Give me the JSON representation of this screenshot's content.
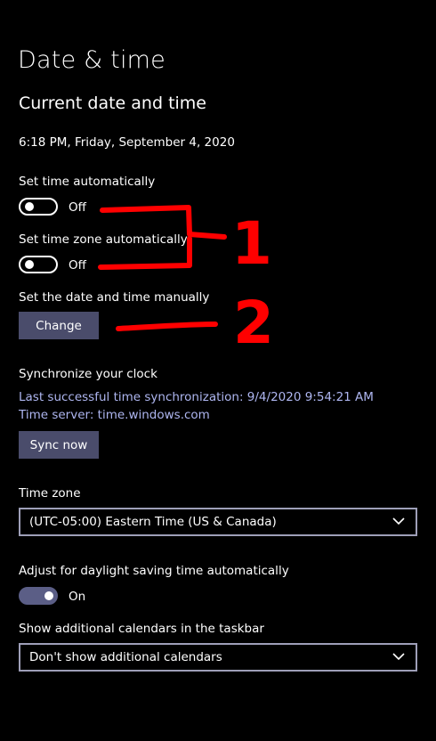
{
  "page": {
    "title": "Date & time"
  },
  "current": {
    "heading": "Current date and time",
    "datetime": "6:18 PM, Friday, September 4, 2020"
  },
  "set_time_auto": {
    "label": "Set time automatically",
    "state": "Off"
  },
  "set_timezone_auto": {
    "label": "Set time zone automatically",
    "state": "Off"
  },
  "manual": {
    "label": "Set the date and time manually",
    "button": "Change"
  },
  "sync": {
    "heading": "Synchronize your clock",
    "last_sync": "Last successful time synchronization: 9/4/2020 9:54:21 AM",
    "server": "Time server: time.windows.com",
    "button": "Sync now"
  },
  "timezone": {
    "label": "Time zone",
    "value": "(UTC-05:00) Eastern Time (US & Canada)"
  },
  "dst": {
    "label": "Adjust for daylight saving time automatically",
    "state": "On"
  },
  "calendars": {
    "label": "Show additional calendars in the taskbar",
    "value": "Don't show additional calendars"
  },
  "annotations": {
    "marker_1": "1",
    "marker_2": "2"
  },
  "colors": {
    "background": "#000000",
    "link": "#aeb6f0",
    "button": "#4a4c6b",
    "toggle_on": "#5b5e86",
    "annotation": "#ff0000"
  }
}
